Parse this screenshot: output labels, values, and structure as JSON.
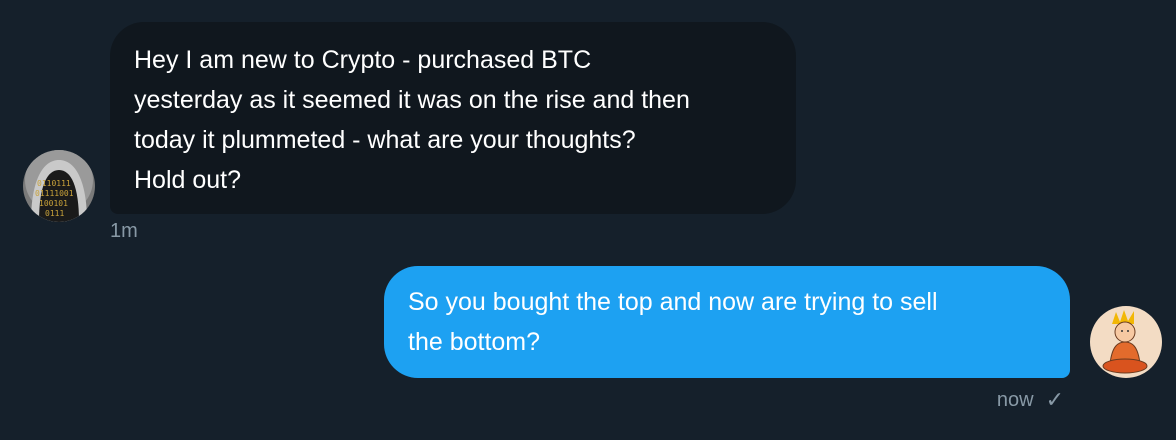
{
  "conversation": {
    "messages": [
      {
        "direction": "incoming",
        "text": "Hey I am new to Crypto - purchased BTC\nyesterday as it seemed it was on the rise and then\ntoday it plummeted - what are your thoughts?\nHold out?",
        "timestamp": "1m",
        "avatar_icon": "hooded-binary-avatar-icon"
      },
      {
        "direction": "outgoing",
        "text": "So you bought the top and now are trying to sell\nthe bottom?",
        "timestamp": "now",
        "status_icon": "checkmark-icon",
        "status_glyph": "✓",
        "avatar_icon": "meditating-monk-avatar-icon"
      }
    ]
  },
  "colors": {
    "background": "#15202b",
    "incoming_bubble": "#10171e",
    "outgoing_bubble": "#1da1f2",
    "meta_text": "#8899a6"
  }
}
